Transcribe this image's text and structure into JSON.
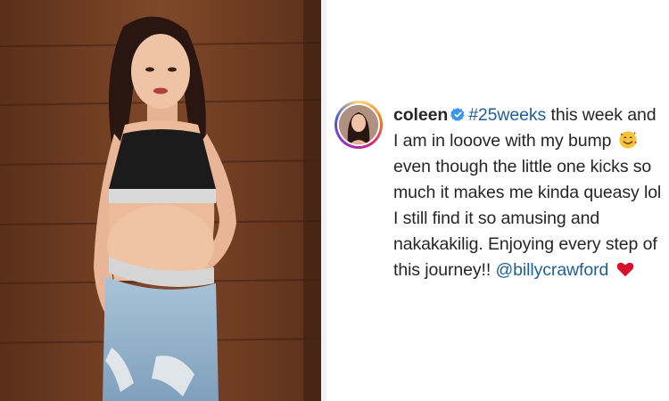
{
  "post": {
    "username": "coleen",
    "verified_icon": "verified-badge-icon",
    "hashtag": "#25weeks",
    "caption_part1": " this week and I am in looove with my bump ",
    "emoji_1": "smiling-face-with-hearts-emoji",
    "caption_part2": " even though the little one kicks so much it makes me kinda queasy lol I still find it so amusing and nakakakilig. Enjoying every step of this journey!!",
    "mention": "@billycrawford",
    "emoji_2": "red-heart-emoji"
  },
  "colors": {
    "link": "#1f5f99",
    "text": "#262626",
    "heart": "#d9102a",
    "verified": "#3897f0"
  }
}
